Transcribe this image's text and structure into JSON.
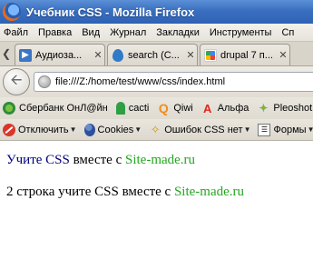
{
  "window": {
    "title": "Учебник CSS - Mozilla Firefox"
  },
  "menu": [
    "Файл",
    "Правка",
    "Вид",
    "Журнал",
    "Закладки",
    "Инструменты",
    "Сп"
  ],
  "tabs": [
    {
      "label": "Аудиоза...",
      "icon": "audio-icon"
    },
    {
      "label": "search (C...",
      "icon": "drupal-icon"
    },
    {
      "label": "drupal 7 п...",
      "icon": "google-icon"
    }
  ],
  "navigation": {
    "url": "file:///Z:/home/test/www/css/index.html"
  },
  "bookmarks": [
    {
      "label": "Сбербанк ОнЛ@йн",
      "icon": "sberbank-icon"
    },
    {
      "label": "cacti",
      "icon": "cacti-icon"
    },
    {
      "label": "Qiwi",
      "icon": "qiwi-icon"
    },
    {
      "label": "Альфа",
      "icon": "alfa-icon"
    },
    {
      "label": "Pleoshot",
      "icon": "pleoshot-icon"
    }
  ],
  "devtools": [
    {
      "label": "Отключить",
      "icon": "disable-icon"
    },
    {
      "label": "Cookies",
      "icon": "cookies-icon"
    },
    {
      "label": "Ошибок CSS нет",
      "icon": "css-icon"
    },
    {
      "label": "Формы",
      "icon": "forms-icon"
    }
  ],
  "content": {
    "line1": {
      "part1": "Учите CSS",
      "part2": " вместе с ",
      "part3": "Site-made.ru"
    },
    "line2": {
      "part1": "2 строка учите CSS вместе с ",
      "part2": "Site-made.ru"
    }
  },
  "colors": {
    "titlebar": "#3a6fc0",
    "link_navy": "#00007c",
    "link_green": "#22a81e"
  }
}
